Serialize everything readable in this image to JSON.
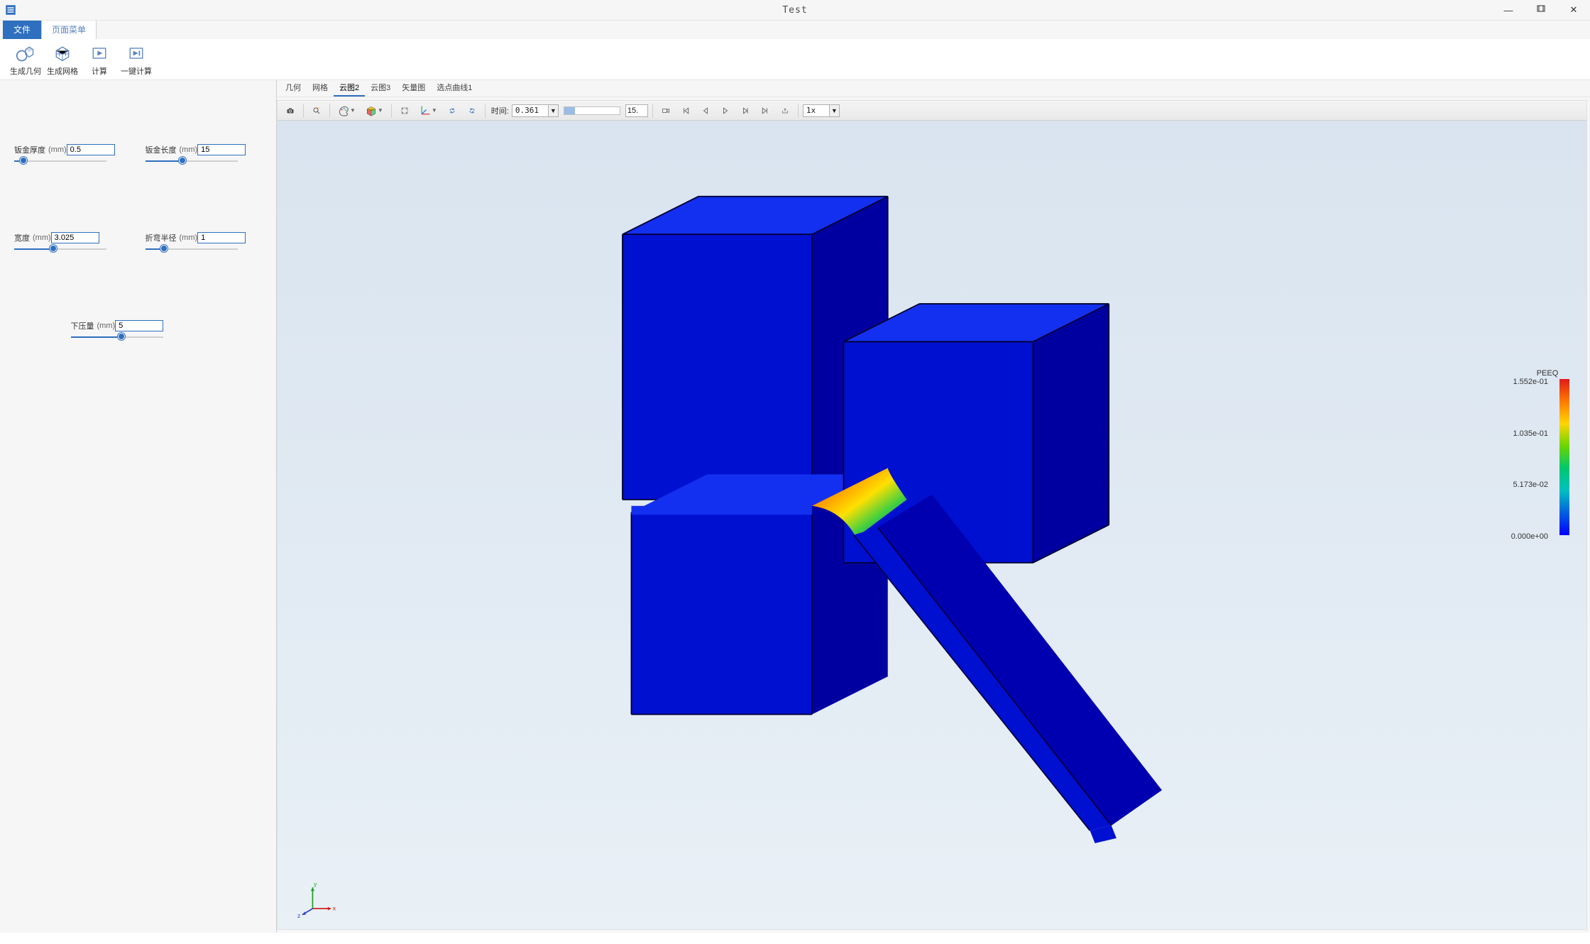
{
  "window": {
    "title": "Test"
  },
  "tabs": {
    "file": "文件",
    "page_menu": "页面菜单"
  },
  "ribbon": {
    "gen_geom": "生成几何",
    "gen_mesh": "生成网格",
    "compute": "计算",
    "one_click_compute": "一键计算"
  },
  "params": {
    "thickness": {
      "label": "钣金厚度",
      "unit": "(mm)",
      "value": "0.5",
      "pct": 10
    },
    "length": {
      "label": "钣金长度",
      "unit": "(mm)",
      "value": "15",
      "pct": 40
    },
    "width": {
      "label": "宽度",
      "unit": "(mm)",
      "value": "3.025",
      "pct": 42
    },
    "bend_radius": {
      "label": "折弯半径",
      "unit": "(mm)",
      "value": "1",
      "pct": 20
    },
    "press": {
      "label": "下压量",
      "unit": "(mm)",
      "value": "5",
      "pct": 55
    }
  },
  "viewerTabs": {
    "geom": "几何",
    "mesh": "网格",
    "cloud2": "云图2",
    "cloud3": "云图3",
    "vector": "矢量图",
    "curve": "选点曲线1"
  },
  "toolbar": {
    "time_label": "时间:",
    "time_value": "0.361",
    "frame": "15.",
    "speed": "1x"
  },
  "legend": {
    "title": "PEEQ",
    "t0": "1.552e-01",
    "t1": "1.035e-01",
    "t2": "5.173e-02",
    "t3": "0.000e+00"
  },
  "triad": {
    "x": "x",
    "y": "y",
    "z": "z"
  }
}
